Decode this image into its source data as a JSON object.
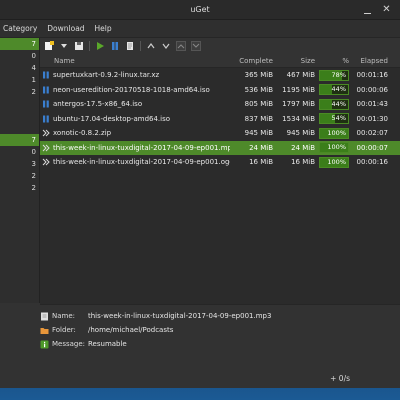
{
  "window": {
    "title": "uGet"
  },
  "menu": [
    "Category",
    "Download",
    "Help"
  ],
  "sidebar": {
    "items": [
      {
        "label": "7",
        "selected": true
      },
      {
        "label": "0",
        "selected": false
      },
      {
        "label": "4",
        "selected": false
      },
      {
        "label": "1",
        "selected": false
      },
      {
        "label": "2",
        "selected": false
      },
      {
        "label": "",
        "selected": false
      },
      {
        "label": "",
        "selected": false
      },
      {
        "label": "",
        "selected": false
      },
      {
        "label": "7",
        "selected": true
      },
      {
        "label": "0",
        "selected": false
      },
      {
        "label": "3",
        "selected": false
      },
      {
        "label": "2",
        "selected": false
      },
      {
        "label": "2",
        "selected": false
      }
    ]
  },
  "columns": {
    "name": "Name",
    "complete": "Complete",
    "size": "Size",
    "percent": "%",
    "elapsed": "Elapsed"
  },
  "downloads": [
    {
      "name": "supertuxkart-0.9.2-linux.tar.xz",
      "complete": "365 MiB",
      "size": "467 MiB",
      "percent": 78,
      "elapsed": "00:01:16",
      "status": "paused",
      "selected": false
    },
    {
      "name": "neon-useredition-20170518-1018-amd64.iso",
      "complete": "536 MiB",
      "size": "1195 MiB",
      "percent": 44,
      "elapsed": "00:00:06",
      "status": "paused",
      "selected": false
    },
    {
      "name": "antergos-17.5-x86_64.iso",
      "complete": "805 MiB",
      "size": "1797 MiB",
      "percent": 44,
      "elapsed": "00:01:43",
      "status": "paused",
      "selected": false
    },
    {
      "name": "ubuntu-17.04-desktop-amd64.iso",
      "complete": "837 MiB",
      "size": "1534 MiB",
      "percent": 54,
      "elapsed": "00:01:30",
      "status": "paused",
      "selected": false
    },
    {
      "name": "xonotic-0.8.2.zip",
      "complete": "945 MiB",
      "size": "945 MiB",
      "percent": 100,
      "elapsed": "00:02:07",
      "status": "done",
      "selected": false
    },
    {
      "name": "this-week-in-linux-tuxdigital-2017-04-09-ep001.mp3",
      "complete": "24 MiB",
      "size": "24 MiB",
      "percent": 100,
      "elapsed": "00:00:07",
      "status": "done",
      "selected": true
    },
    {
      "name": "this-week-in-linux-tuxdigital-2017-04-09-ep001.ogg",
      "complete": "16 MiB",
      "size": "16 MiB",
      "percent": 100,
      "elapsed": "00:00:16",
      "status": "done",
      "selected": false
    }
  ],
  "details": {
    "name_label": "Name:",
    "name_value": "this-week-in-linux-tuxdigital-2017-04-09-ep001.mp3",
    "folder_label": "Folder:",
    "folder_value": "/home/michael/Podcasts",
    "message_label": "Message:",
    "message_value": "Resumable"
  },
  "status": {
    "speed": "+ 0/s"
  },
  "colors": {
    "accent": "#4e8a2a",
    "paused": "#3a7fd0"
  }
}
